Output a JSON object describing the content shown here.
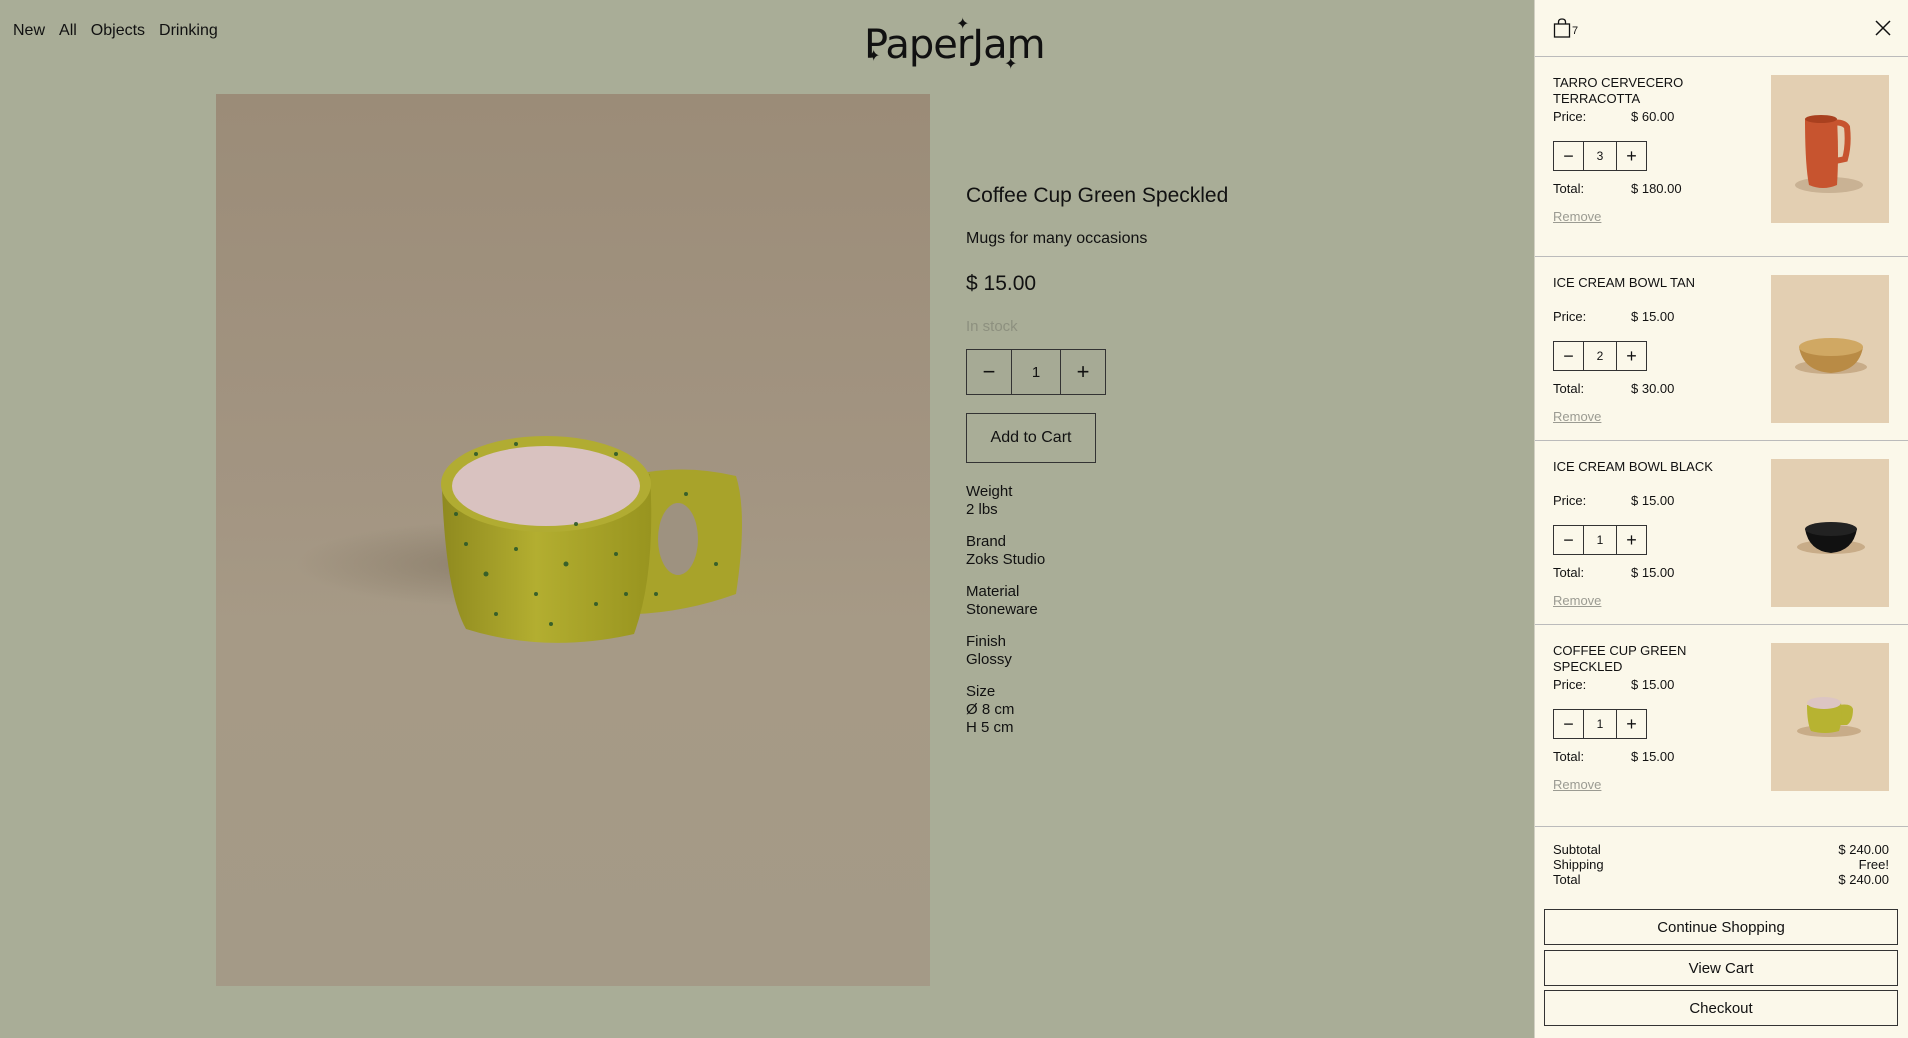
{
  "nav": {
    "items": [
      "New",
      "All",
      "Objects",
      "Drinking"
    ]
  },
  "logo": {
    "text": "PaperJam"
  },
  "product": {
    "title": "Coffee Cup Green Speckled",
    "subtitle": "Mugs for many occasions",
    "price": "$ 15.00",
    "stock": "In stock",
    "quantity": "1",
    "add_to_cart": "Add to Cart",
    "specs": [
      {
        "label": "Weight",
        "values": [
          "2 lbs"
        ]
      },
      {
        "label": "Brand",
        "values": [
          "Zoks Studio"
        ]
      },
      {
        "label": "Material",
        "values": [
          "Stoneware"
        ]
      },
      {
        "label": "Finish",
        "values": [
          "Glossy"
        ]
      },
      {
        "label": "Size",
        "values": [
          "Ø 8 cm",
          "H 5 cm"
        ]
      }
    ]
  },
  "cart": {
    "count": "7",
    "price_label": "Price:",
    "total_label": "Total:",
    "remove_label": "Remove",
    "items": [
      {
        "name": "TARRO CERVECERO TERRACOTTA",
        "price": "$ 60.00",
        "qty": "3",
        "total": "$ 180.00",
        "thumb": "mug-terracotta"
      },
      {
        "name": "ICE CREAM BOWL TAN",
        "price": "$ 15.00",
        "qty": "2",
        "total": "$ 30.00",
        "thumb": "bowl-tan"
      },
      {
        "name": "ICE CREAM BOWL BLACK",
        "price": "$ 15.00",
        "qty": "1",
        "total": "$ 15.00",
        "thumb": "bowl-black"
      },
      {
        "name": "COFFEE CUP GREEN SPECKLED",
        "price": "$ 15.00",
        "qty": "1",
        "total": "$ 15.00",
        "thumb": "cup-green"
      }
    ],
    "summary": {
      "subtotal_label": "Subtotal",
      "subtotal": "$ 240.00",
      "shipping_label": "Shipping",
      "shipping": "Free!",
      "total_label": "Total",
      "total": "$ 240.00"
    },
    "buttons": {
      "continue": "Continue Shopping",
      "view": "View Cart",
      "checkout": "Checkout"
    }
  },
  "colors": {
    "page_bg": "#a9ad97",
    "drawer_bg": "#fbf8ea",
    "terracotta": "#c7542f",
    "speckle_green": "#b7b331"
  }
}
